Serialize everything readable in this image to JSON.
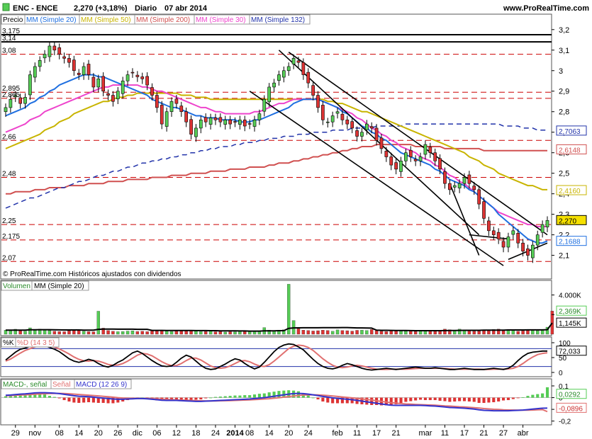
{
  "header": {
    "icon": "green-square-icon",
    "ticker": "ENC - ENCE",
    "last": "2,270 (+3,18%)",
    "period": "Diario",
    "date": "07 abr 2014",
    "site": "www.ProRealTime.com"
  },
  "colors": {
    "price_up": "#55cc55",
    "price_down": "#dd3333",
    "sma20": "#1f6fe0",
    "sma50": "#c8b400",
    "sma200": "#d05050",
    "sma30": "#ee44cc",
    "sma132": "#2233aa",
    "resistance": "#cc0000",
    "trendline": "#000000",
    "vol_up": "#55cc55",
    "vol_down": "#dd3333",
    "k_line": "#000000",
    "d_line": "#e07070",
    "macd_line": "#3333cc",
    "signal_line": "#e07070"
  },
  "legend": {
    "price": "Precio",
    "sma20": "MM (Simple 20)",
    "sma50": "MM (Simple 50)",
    "sma200": "MM (Simple 200)",
    "sma30": "MM (Simple 30)",
    "sma132": "MM (Simple 132)"
  },
  "note": "© ProRealTime.com Históricos ajustados con dividendos",
  "volume_legend": {
    "volume": "Volumen",
    "sma": "MM (Simple 20)"
  },
  "stoch_legend": {
    "k": "%K",
    "d": "%D (14 3 5)"
  },
  "macd_legend": {
    "hist": "MACD-, señal",
    "signal": "Señal",
    "macd": "MACD (12 26 9)"
  },
  "price_ticks": [
    "3,2",
    "3,1",
    "3",
    "2,9",
    "2,8",
    "2,7",
    "2,6",
    "2,5",
    "2,4",
    "2,3",
    "2,2",
    "2,1"
  ],
  "level_labels": [
    "3,175",
    "3,14",
    "3,08",
    "2,895",
    "2,865",
    "2,66",
    "2,48",
    "2,25",
    "2,175",
    "2,07"
  ],
  "value_tags": {
    "sma132": "2,7063",
    "sma200": "2,6148",
    "sma50": "2,4160",
    "price": "2,270",
    "sma20": "2,1688"
  },
  "volume_ticks": [
    "4.000K",
    "2.000K"
  ],
  "volume_tags": {
    "volume": "2,369K",
    "sma": "1,145K"
  },
  "stoch_ticks": [
    "100",
    "50",
    "0"
  ],
  "stoch_tag": "72,033",
  "macd_ticks": [
    "0,1",
    "0",
    "-0,1",
    "-0,2"
  ],
  "macd_tags": {
    "hist": "0,0292",
    "macd": "-0,0896"
  },
  "x_labels": [
    "29",
    "nov",
    "08",
    "14",
    "20",
    "26",
    "dic",
    "06",
    "12",
    "18",
    "24",
    "2014",
    "08",
    "14",
    "20",
    "24",
    "feb",
    "11",
    "17",
    "21",
    "mar",
    "11",
    "17",
    "21",
    "27",
    "abr"
  ],
  "chart_data": {
    "type": "candlestick",
    "title": "ENC - ENCE  2,270 (+3,18%)  Diario 07 abr 2014",
    "ylim": [
      2.04,
      3.22
    ],
    "hlines": [
      3.175,
      3.14,
      3.08,
      2.895,
      2.865,
      2.66,
      2.48,
      2.25,
      2.175,
      2.07
    ],
    "sessions": 112,
    "close": [
      2.82,
      2.86,
      2.88,
      2.84,
      2.87,
      2.98,
      3.02,
      3.05,
      3.08,
      3.12,
      3.1,
      3.08,
      3.06,
      3.04,
      3.0,
      2.98,
      3.02,
      2.98,
      2.92,
      2.96,
      2.9,
      2.88,
      2.85,
      2.9,
      2.95,
      2.98,
      2.99,
      2.97,
      2.96,
      2.93,
      2.88,
      2.82,
      2.74,
      2.8,
      2.85,
      2.84,
      2.8,
      2.75,
      2.69,
      2.72,
      2.76,
      2.75,
      2.77,
      2.76,
      2.75,
      2.76,
      2.74,
      2.75,
      2.76,
      2.73,
      2.74,
      2.76,
      2.79,
      2.86,
      2.92,
      2.94,
      2.98,
      3.0,
      3.02,
      3.06,
      3.04,
      2.98,
      2.94,
      2.88,
      2.82,
      2.76,
      2.75,
      2.78,
      2.8,
      2.76,
      2.74,
      2.72,
      2.68,
      2.7,
      2.74,
      2.72,
      2.66,
      2.62,
      2.58,
      2.54,
      2.52,
      2.56,
      2.6,
      2.58,
      2.56,
      2.58,
      2.64,
      2.6,
      2.56,
      2.52,
      2.45,
      2.42,
      2.44,
      2.45,
      2.48,
      2.45,
      2.42,
      2.35,
      2.28,
      2.22,
      2.2,
      2.18,
      2.14,
      2.19,
      2.22,
      2.16,
      2.12,
      2.1,
      2.15,
      2.2,
      2.25,
      2.27
    ],
    "sma20": [
      2.78,
      2.79,
      2.8,
      2.81,
      2.82,
      2.84,
      2.85,
      2.87,
      2.88,
      2.9,
      2.91,
      2.93,
      2.94,
      2.95,
      2.96,
      2.97,
      2.98,
      2.98,
      2.98,
      2.97,
      2.97,
      2.96,
      2.95,
      2.94,
      2.93,
      2.92,
      2.91,
      2.9,
      2.89,
      2.88,
      2.86,
      2.85,
      2.84,
      2.83,
      2.82,
      2.82,
      2.81,
      2.8,
      2.79,
      2.78,
      2.78,
      2.77,
      2.77,
      2.77,
      2.76,
      2.76,
      2.76,
      2.76,
      2.75,
      2.75,
      2.75,
      2.76,
      2.76,
      2.77,
      2.78,
      2.79,
      2.8,
      2.81,
      2.82,
      2.84,
      2.85,
      2.86,
      2.86,
      2.86,
      2.86,
      2.85,
      2.84,
      2.83,
      2.82,
      2.8,
      2.79,
      2.77,
      2.75,
      2.73,
      2.72,
      2.7,
      2.69,
      2.67,
      2.66,
      2.64,
      2.62,
      2.6,
      2.59,
      2.58,
      2.57,
      2.56,
      2.55,
      2.54,
      2.52,
      2.51,
      2.49,
      2.47,
      2.46,
      2.45,
      2.44,
      2.42,
      2.41,
      2.39,
      2.37,
      2.35,
      2.33,
      2.3,
      2.28,
      2.26,
      2.24,
      2.22,
      2.2,
      2.18,
      2.17,
      2.16,
      2.16,
      2.17
    ],
    "sma30": [
      2.7,
      2.71,
      2.72,
      2.73,
      2.74,
      2.76,
      2.77,
      2.78,
      2.8,
      2.81,
      2.82,
      2.83,
      2.84,
      2.85,
      2.86,
      2.87,
      2.88,
      2.89,
      2.9,
      2.91,
      2.92,
      2.92,
      2.93,
      2.93,
      2.93,
      2.93,
      2.93,
      2.93,
      2.92,
      2.92,
      2.91,
      2.9,
      2.9,
      2.89,
      2.88,
      2.87,
      2.86,
      2.85,
      2.84,
      2.83,
      2.82,
      2.82,
      2.81,
      2.8,
      2.8,
      2.79,
      2.79,
      2.79,
      2.79,
      2.79,
      2.79,
      2.8,
      2.8,
      2.81,
      2.82,
      2.83,
      2.84,
      2.84,
      2.85,
      2.86,
      2.86,
      2.86,
      2.86,
      2.86,
      2.86,
      2.85,
      2.84,
      2.83,
      2.82,
      2.81,
      2.8,
      2.79,
      2.77,
      2.76,
      2.74,
      2.72,
      2.71,
      2.69,
      2.68,
      2.66,
      2.65,
      2.63,
      2.62,
      2.61,
      2.6,
      2.58,
      2.57,
      2.56,
      2.54,
      2.53,
      2.51,
      2.49,
      2.48,
      2.46,
      2.45,
      2.43,
      2.41,
      2.39,
      2.37,
      2.35,
      2.33,
      2.31,
      2.3,
      2.29,
      2.28,
      2.27,
      2.26,
      2.25,
      2.25,
      2.24,
      2.24,
      2.24
    ],
    "sma50": [
      2.62,
      2.63,
      2.64,
      2.65,
      2.66,
      2.67,
      2.68,
      2.69,
      2.71,
      2.72,
      2.73,
      2.75,
      2.76,
      2.77,
      2.79,
      2.8,
      2.81,
      2.82,
      2.83,
      2.84,
      2.85,
      2.85,
      2.86,
      2.87,
      2.87,
      2.88,
      2.88,
      2.89,
      2.89,
      2.89,
      2.89,
      2.89,
      2.89,
      2.89,
      2.89,
      2.89,
      2.88,
      2.88,
      2.88,
      2.87,
      2.87,
      2.87,
      2.86,
      2.86,
      2.86,
      2.86,
      2.86,
      2.86,
      2.86,
      2.86,
      2.86,
      2.86,
      2.86,
      2.86,
      2.86,
      2.86,
      2.86,
      2.86,
      2.86,
      2.86,
      2.86,
      2.86,
      2.86,
      2.86,
      2.86,
      2.86,
      2.85,
      2.85,
      2.84,
      2.84,
      2.83,
      2.82,
      2.81,
      2.8,
      2.8,
      2.79,
      2.78,
      2.77,
      2.76,
      2.75,
      2.74,
      2.73,
      2.72,
      2.71,
      2.7,
      2.69,
      2.68,
      2.67,
      2.66,
      2.65,
      2.64,
      2.63,
      2.62,
      2.61,
      2.6,
      2.58,
      2.57,
      2.56,
      2.54,
      2.53,
      2.52,
      2.5,
      2.49,
      2.48,
      2.47,
      2.46,
      2.45,
      2.44,
      2.44,
      2.43,
      2.42,
      2.42
    ],
    "sma132": [
      2.33,
      2.34,
      2.35,
      2.36,
      2.37,
      2.38,
      2.38,
      2.39,
      2.4,
      2.41,
      2.42,
      2.43,
      2.43,
      2.44,
      2.45,
      2.46,
      2.46,
      2.47,
      2.48,
      2.49,
      2.49,
      2.5,
      2.51,
      2.51,
      2.52,
      2.53,
      2.53,
      2.54,
      2.55,
      2.55,
      2.56,
      2.56,
      2.57,
      2.57,
      2.58,
      2.58,
      2.59,
      2.59,
      2.6,
      2.6,
      2.61,
      2.61,
      2.62,
      2.62,
      2.63,
      2.63,
      2.63,
      2.64,
      2.64,
      2.65,
      2.65,
      2.65,
      2.66,
      2.66,
      2.67,
      2.67,
      2.67,
      2.68,
      2.68,
      2.68,
      2.69,
      2.69,
      2.69,
      2.7,
      2.7,
      2.7,
      2.7,
      2.71,
      2.71,
      2.71,
      2.71,
      2.72,
      2.72,
      2.72,
      2.72,
      2.72,
      2.73,
      2.73,
      2.73,
      2.73,
      2.73,
      2.73,
      2.74,
      2.74,
      2.74,
      2.74,
      2.74,
      2.74,
      2.74,
      2.74,
      2.74,
      2.74,
      2.74,
      2.74,
      2.74,
      2.74,
      2.74,
      2.74,
      2.74,
      2.74,
      2.74,
      2.74,
      2.73,
      2.73,
      2.73,
      2.73,
      2.72,
      2.72,
      2.72,
      2.71,
      2.71,
      2.71
    ],
    "sma200": [
      2.4,
      2.4,
      2.41,
      2.41,
      2.41,
      2.41,
      2.42,
      2.42,
      2.42,
      2.43,
      2.43,
      2.43,
      2.43,
      2.44,
      2.44,
      2.44,
      2.44,
      2.45,
      2.45,
      2.45,
      2.45,
      2.46,
      2.46,
      2.46,
      2.46,
      2.47,
      2.47,
      2.47,
      2.47,
      2.47,
      2.48,
      2.48,
      2.48,
      2.48,
      2.49,
      2.49,
      2.49,
      2.49,
      2.5,
      2.5,
      2.5,
      2.5,
      2.51,
      2.51,
      2.51,
      2.51,
      2.52,
      2.52,
      2.52,
      2.52,
      2.53,
      2.53,
      2.53,
      2.53,
      2.54,
      2.54,
      2.55,
      2.55,
      2.55,
      2.56,
      2.56,
      2.57,
      2.57,
      2.58,
      2.58,
      2.59,
      2.59,
      2.6,
      2.6,
      2.61,
      2.61,
      2.62,
      2.62,
      2.63,
      2.63,
      2.63,
      2.64,
      2.64,
      2.64,
      2.64,
      2.64,
      2.64,
      2.64,
      2.64,
      2.63,
      2.63,
      2.63,
      2.63,
      2.63,
      2.63,
      2.62,
      2.62,
      2.62,
      2.62,
      2.62,
      2.62,
      2.62,
      2.62,
      2.61,
      2.61,
      2.61,
      2.61,
      2.61,
      2.61,
      2.61,
      2.61,
      2.61,
      2.61,
      2.61,
      2.61,
      2.61,
      2.61
    ],
    "volume_k": [
      420,
      380,
      510,
      360,
      300,
      650,
      480,
      520,
      430,
      380,
      300,
      280,
      260,
      350,
      420,
      380,
      300,
      260,
      250,
      2350,
      620,
      380,
      300,
      260,
      280,
      320,
      350,
      280,
      300,
      260,
      330,
      380,
      420,
      300,
      280,
      320,
      360,
      380,
      420,
      300,
      260,
      280,
      300,
      250,
      280,
      220,
      260,
      240,
      300,
      280,
      320,
      280,
      320,
      680,
      420,
      380,
      400,
      450,
      5100,
      1400,
      560,
      420,
      380,
      330,
      360,
      420,
      380,
      300,
      440,
      380,
      360,
      320,
      400,
      420,
      380,
      480,
      360,
      300,
      280,
      420,
      360,
      300,
      320,
      300,
      280,
      300,
      320,
      330,
      380,
      340,
      520,
      460,
      360,
      520,
      440,
      360,
      300,
      320,
      380,
      420,
      480,
      520,
      360,
      480,
      380,
      300,
      340,
      380,
      400,
      360,
      460,
      720,
      2369
    ],
    "volume_sma_k": [
      420,
      420,
      420,
      420,
      420,
      450,
      450,
      460,
      460,
      460,
      450,
      440,
      430,
      430,
      430,
      430,
      420,
      420,
      420,
      500,
      520,
      520,
      520,
      510,
      510,
      510,
      510,
      500,
      500,
      500,
      390,
      390,
      390,
      380,
      380,
      380,
      380,
      380,
      380,
      370,
      370,
      370,
      360,
      360,
      350,
      340,
      340,
      340,
      330,
      330,
      320,
      320,
      320,
      340,
      340,
      350,
      360,
      360,
      600,
      640,
      650,
      660,
      660,
      660,
      660,
      670,
      670,
      670,
      670,
      680,
      680,
      660,
      640,
      640,
      630,
      620,
      410,
      400,
      400,
      390,
      380,
      380,
      380,
      370,
      360,
      360,
      360,
      360,
      360,
      360,
      370,
      380,
      380,
      390,
      400,
      400,
      400,
      400,
      410,
      420,
      420,
      420,
      420,
      430,
      430,
      430,
      430,
      440,
      440,
      440,
      440,
      460,
      1145
    ],
    "stoch_k": [
      42,
      55,
      68,
      78,
      82,
      88,
      92,
      95,
      90,
      84,
      78,
      70,
      58,
      46,
      38,
      34,
      38,
      44,
      40,
      30,
      22,
      18,
      24,
      34,
      42,
      54,
      66,
      72,
      64,
      52,
      40,
      30,
      22,
      20,
      22,
      34,
      48,
      58,
      52,
      38,
      24,
      14,
      10,
      12,
      20,
      28,
      38,
      46,
      42,
      30,
      20,
      12,
      18,
      34,
      52,
      70,
      84,
      92,
      96,
      94,
      86,
      76,
      60,
      44,
      30,
      20,
      14,
      12,
      16,
      24,
      30,
      26,
      20,
      14,
      10,
      8,
      10,
      12,
      14,
      12,
      10,
      12,
      14,
      16,
      18,
      16,
      14,
      14,
      16,
      14,
      12,
      10,
      10,
      12,
      14,
      12,
      10,
      10,
      10,
      12,
      14,
      12,
      10,
      14,
      24,
      40,
      54,
      64,
      68,
      70,
      72,
      72
    ],
    "stoch_d": [
      38,
      45,
      55,
      65,
      74,
      80,
      86,
      90,
      92,
      90,
      85,
      79,
      71,
      62,
      52,
      44,
      39,
      38,
      40,
      38,
      33,
      27,
      24,
      25,
      30,
      38,
      48,
      58,
      64,
      62,
      56,
      46,
      36,
      28,
      23,
      23,
      30,
      40,
      48,
      48,
      42,
      32,
      22,
      16,
      14,
      16,
      22,
      30,
      38,
      40,
      36,
      28,
      22,
      20,
      26,
      38,
      52,
      66,
      80,
      88,
      92,
      90,
      84,
      74,
      60,
      46,
      34,
      24,
      18,
      16,
      18,
      22,
      24,
      22,
      18,
      14,
      11,
      10,
      10,
      11,
      11,
      11,
      11,
      12,
      13,
      14,
      14,
      14,
      14,
      14,
      13,
      12,
      11,
      11,
      11,
      11,
      11,
      11,
      10,
      10,
      11,
      11,
      11,
      12,
      14,
      20,
      30,
      42,
      52,
      60,
      64,
      66
    ],
    "macd": [
      0.02,
      0.022,
      0.026,
      0.03,
      0.032,
      0.036,
      0.04,
      0.042,
      0.042,
      0.04,
      0.038,
      0.034,
      0.028,
      0.022,
      0.016,
      0.012,
      0.01,
      0.008,
      0.004,
      0.0,
      -0.004,
      -0.008,
      -0.012,
      -0.014,
      -0.014,
      -0.012,
      -0.01,
      -0.008,
      -0.008,
      -0.01,
      -0.014,
      -0.018,
      -0.022,
      -0.024,
      -0.024,
      -0.024,
      -0.026,
      -0.028,
      -0.03,
      -0.032,
      -0.032,
      -0.03,
      -0.028,
      -0.026,
      -0.024,
      -0.022,
      -0.02,
      -0.018,
      -0.016,
      -0.014,
      -0.012,
      -0.008,
      -0.004,
      0.0,
      0.006,
      0.012,
      0.018,
      0.024,
      0.03,
      0.034,
      0.036,
      0.034,
      0.03,
      0.024,
      0.018,
      0.01,
      0.004,
      -0.002,
      -0.006,
      -0.01,
      -0.014,
      -0.018,
      -0.024,
      -0.03,
      -0.036,
      -0.042,
      -0.048,
      -0.054,
      -0.06,
      -0.064,
      -0.066,
      -0.066,
      -0.066,
      -0.066,
      -0.066,
      -0.066,
      -0.068,
      -0.07,
      -0.072,
      -0.076,
      -0.08,
      -0.084,
      -0.086,
      -0.088,
      -0.09,
      -0.094,
      -0.098,
      -0.104,
      -0.108,
      -0.11,
      -0.112,
      -0.112,
      -0.112,
      -0.112,
      -0.11,
      -0.108,
      -0.106,
      -0.102,
      -0.098,
      -0.094,
      -0.09,
      -0.0896
    ],
    "macd_signal": [
      0.016,
      0.018,
      0.02,
      0.022,
      0.024,
      0.026,
      0.029,
      0.031,
      0.033,
      0.035,
      0.036,
      0.036,
      0.035,
      0.033,
      0.03,
      0.027,
      0.024,
      0.021,
      0.018,
      0.015,
      0.011,
      0.008,
      0.004,
      0.0,
      -0.003,
      -0.005,
      -0.006,
      -0.007,
      -0.008,
      -0.008,
      -0.009,
      -0.01,
      -0.013,
      -0.015,
      -0.017,
      -0.019,
      -0.021,
      -0.022,
      -0.024,
      -0.026,
      -0.027,
      -0.028,
      -0.028,
      -0.028,
      -0.027,
      -0.026,
      -0.025,
      -0.024,
      -0.022,
      -0.021,
      -0.019,
      -0.017,
      -0.015,
      -0.012,
      -0.009,
      -0.005,
      -0.001,
      0.004,
      0.009,
      0.014,
      0.018,
      0.022,
      0.024,
      0.024,
      0.023,
      0.021,
      0.018,
      0.014,
      0.01,
      0.006,
      0.002,
      -0.002,
      -0.006,
      -0.011,
      -0.016,
      -0.021,
      -0.027,
      -0.032,
      -0.038,
      -0.043,
      -0.047,
      -0.051,
      -0.054,
      -0.056,
      -0.058,
      -0.06,
      -0.061,
      -0.063,
      -0.065,
      -0.067,
      -0.07,
      -0.072,
      -0.075,
      -0.078,
      -0.08,
      -0.083,
      -0.086,
      -0.089,
      -0.093,
      -0.096,
      -0.099,
      -0.101,
      -0.104,
      -0.105,
      -0.106,
      -0.107,
      -0.107,
      -0.107,
      -0.106,
      -0.104,
      -0.102,
      -0.119
    ]
  }
}
